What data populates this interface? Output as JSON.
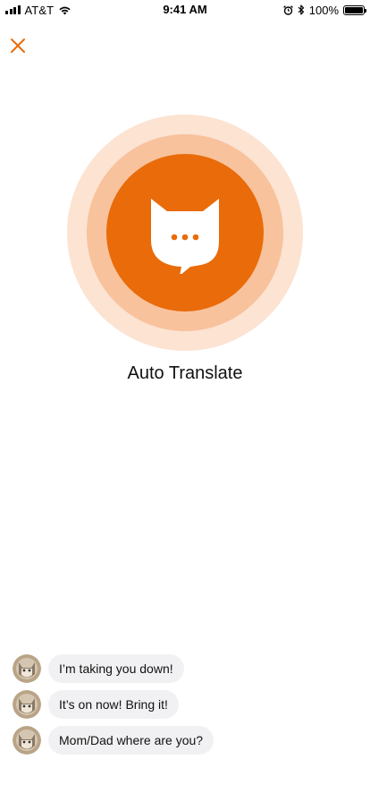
{
  "status_bar": {
    "carrier": "AT&T",
    "time": "9:41 AM",
    "battery_percent": "100%",
    "icons": [
      "signal-icon",
      "wifi-icon",
      "alarm-icon",
      "bluetooth-icon",
      "battery-icon"
    ]
  },
  "header": {
    "close_icon": "close-icon"
  },
  "hero": {
    "title": "Auto Translate",
    "icon": "cat-chat-icon"
  },
  "messages": [
    {
      "text": "I’m taking you down!"
    },
    {
      "text": "It’s on now! Bring it!"
    },
    {
      "text": "Mom/Dad where are you?"
    }
  ],
  "colors": {
    "accent": "#e96b09",
    "ring_mid": "#f8c29d",
    "ring_outer": "#fce3d2",
    "bubble_bg": "#f1f1f3"
  }
}
